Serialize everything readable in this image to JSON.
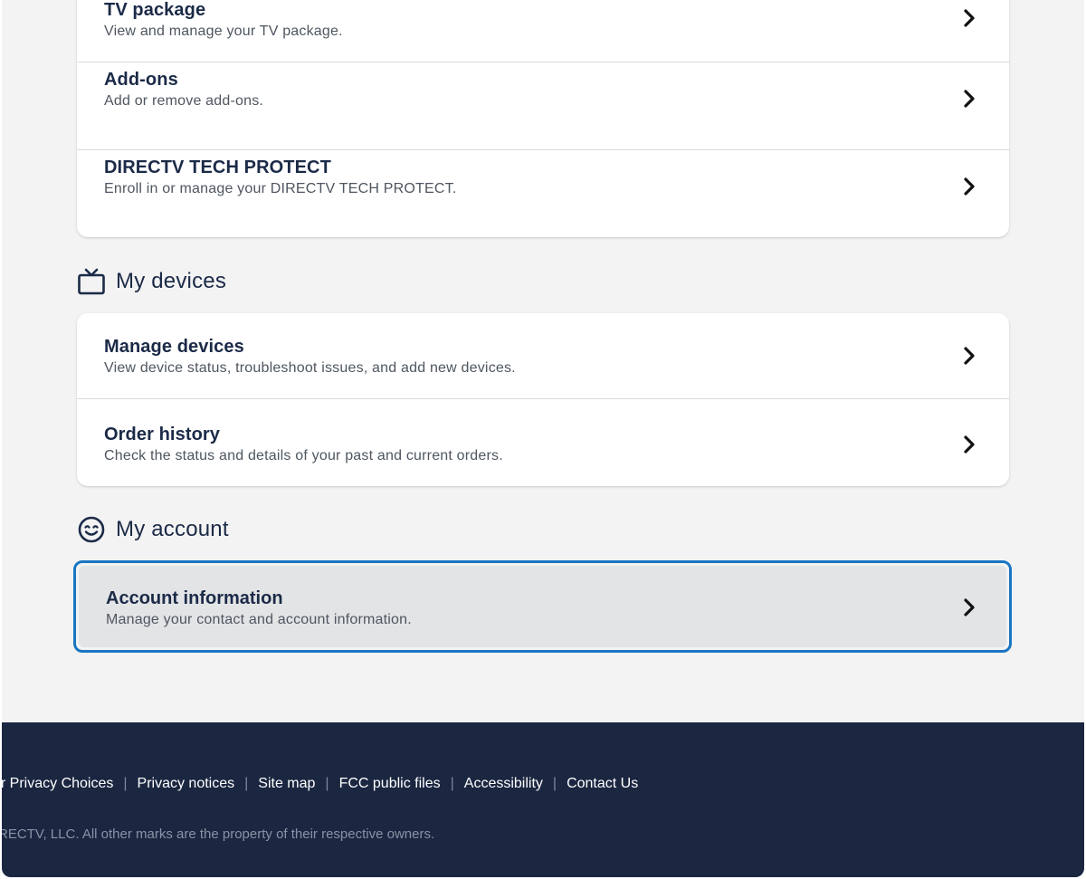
{
  "sections": {
    "tv_items": [
      {
        "title": "TV package",
        "subtitle": "View and manage your TV package."
      },
      {
        "title": "Add-ons",
        "subtitle": "Add or remove add-ons."
      },
      {
        "title": "DIRECTV TECH PROTECT",
        "subtitle": "Enroll in or manage your DIRECTV TECH PROTECT."
      }
    ],
    "devices": {
      "heading": "My devices",
      "icon": "tv-icon",
      "items": [
        {
          "title": "Manage devices",
          "subtitle": "View device status, troubleshoot issues, and add new devices."
        },
        {
          "title": "Order history",
          "subtitle": "Check the status and details of your past and current orders."
        }
      ]
    },
    "account": {
      "heading": "My account",
      "icon": "smile-icon",
      "items": [
        {
          "title": "Account information",
          "subtitle": "Manage your contact and account information."
        }
      ]
    }
  },
  "footer": {
    "links": [
      "ur Privacy Choices",
      "Privacy notices",
      "Site map",
      "FCC public files",
      "Accessibility",
      "Contact Us"
    ],
    "separator": "|",
    "copyright": "RECTV, LLC. All other marks are the property of their respective owners."
  },
  "colors": {
    "page_bg": "#f3f3f3",
    "heading_text": "#1b2a47",
    "focus_outline": "#1a76c2",
    "footer_bg": "#1b2641"
  }
}
